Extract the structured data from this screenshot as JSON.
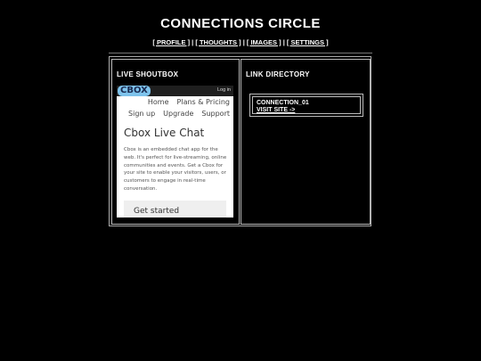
{
  "site": {
    "title": "CONNECTIONS CIRCLE",
    "nav": [
      {
        "label": "[ PROFILE ]"
      },
      {
        "label": "[ THOUGHTS ]"
      },
      {
        "label": "[ IMAGES ]"
      },
      {
        "label": "[ SETTINGS ]"
      }
    ],
    "nav_separator": " | "
  },
  "shoutbox": {
    "title": "LIVE SHOUTBOX",
    "widget": {
      "logo": "CBOX",
      "login": "Log in",
      "nav_row1": [
        "Home",
        "Plans & Pricing"
      ],
      "nav_row2": [
        "Sign up",
        "Upgrade",
        "Support"
      ],
      "heading": "Cbox Live Chat",
      "description": "Cbox is an embedded chat app for the web. It's perfect for live-streaming, online communities and events. Get a Cbox for your site to enable your visitors, users, or customers to engage in real-time conversation.",
      "cta": "Get started"
    }
  },
  "directory": {
    "title": "LINK DIRECTORY",
    "links": [
      {
        "name": "CONNECTION_01",
        "action": "VISIT SITE ->"
      }
    ]
  }
}
